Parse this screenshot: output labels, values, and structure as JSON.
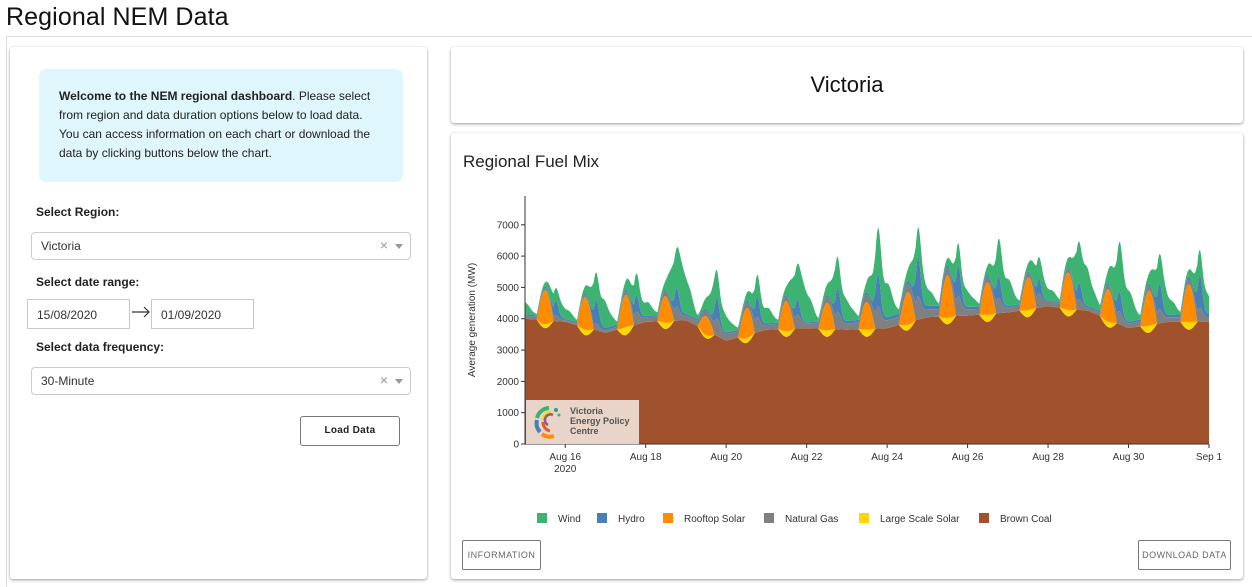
{
  "page_title": "Regional NEM Data",
  "welcome": {
    "bold": "Welcome to the NEM regional dashboard",
    "text": ". Please select from region and data duration options below to load data. You can access information on each chart or download the data by clicking buttons below the chart."
  },
  "controls": {
    "region_label": "Select Region:",
    "region_value": "Victoria",
    "date_label": "Select date range:",
    "date_start": "15/08/2020",
    "date_end": "01/09/2020",
    "frequency_label": "Select data frequency:",
    "frequency_value": "30-Minute",
    "clear_symbol": "×",
    "load_button": "Load Data"
  },
  "region_title": "Victoria",
  "chart_title": "Regional Fuel Mix",
  "buttons": {
    "information": "INFORMATION",
    "download": "DOWNLOAD DATA"
  },
  "logo": {
    "line1": "Victoria",
    "line2": "Energy Policy",
    "line3": "Centre"
  },
  "colors": {
    "wind": "#3cb371",
    "hydro": "#4a7fb5",
    "rooftop_solar": "#ff8c00",
    "natural_gas": "#808080",
    "large_scale_solar": "#ffd700",
    "brown_coal": "#a0522d",
    "welcome_bg": "#dff6fc"
  },
  "chart_data": {
    "type": "area",
    "stacked": true,
    "title": "Regional Fuel Mix",
    "ylabel": "Average generation (MW)",
    "xlabel": "",
    "ylim": [
      0,
      7600
    ],
    "xlim": [
      "2020-08-15",
      "2020-09-01"
    ],
    "yticks": [
      0,
      1000,
      2000,
      3000,
      4000,
      5000,
      6000,
      7000
    ],
    "xticks": [
      {
        "date": "2020-08-16",
        "label": "Aug 16",
        "sublabel": "2020"
      },
      {
        "date": "2020-08-18",
        "label": "Aug 18"
      },
      {
        "date": "2020-08-20",
        "label": "Aug 20"
      },
      {
        "date": "2020-08-22",
        "label": "Aug 22"
      },
      {
        "date": "2020-08-24",
        "label": "Aug 24"
      },
      {
        "date": "2020-08-26",
        "label": "Aug 26"
      },
      {
        "date": "2020-08-28",
        "label": "Aug 28"
      },
      {
        "date": "2020-08-30",
        "label": "Aug 30"
      },
      {
        "date": "2020-09-01",
        "label": "Sep 1"
      }
    ],
    "legend_position": "bottom",
    "series_order": [
      "Brown Coal",
      "Large Scale Solar",
      "Rooftop Solar",
      "Natural Gas",
      "Hydro",
      "Wind"
    ],
    "legend": [
      "Wind",
      "Hydro",
      "Rooftop Solar",
      "Natural Gas",
      "Large Scale Solar",
      "Brown Coal"
    ],
    "series_colors": {
      "Wind": "#3cb371",
      "Hydro": "#4a7fb5",
      "Rooftop Solar": "#ff8c00",
      "Natural Gas": "#808080",
      "Large Scale Solar": "#ffd700",
      "Brown Coal": "#a0522d"
    },
    "daily": [
      {
        "date": "2020-08-15",
        "Brown Coal": 4000,
        "Large Scale Solar": 100,
        "Rooftop Solar": 650,
        "Natural Gas": 200,
        "Hydro": 250,
        "Wind": 500
      },
      {
        "date": "2020-08-16",
        "Brown Coal": 3900,
        "Large Scale Solar": 150,
        "Rooftop Solar": 700,
        "Natural Gas": 100,
        "Hydro": 200,
        "Wind": 500
      },
      {
        "date": "2020-08-17",
        "Brown Coal": 3550,
        "Large Scale Solar": 200,
        "Rooftop Solar": 600,
        "Natural Gas": 150,
        "Hydro": 400,
        "Wind": 1100
      },
      {
        "date": "2020-08-18",
        "Brown Coal": 3900,
        "Large Scale Solar": 300,
        "Rooftop Solar": 700,
        "Natural Gas": 300,
        "Hydro": 200,
        "Wind": 600
      },
      {
        "date": "2020-08-19",
        "Brown Coal": 3950,
        "Large Scale Solar": 100,
        "Rooftop Solar": 350,
        "Natural Gas": 300,
        "Hydro": 300,
        "Wind": 1800
      },
      {
        "date": "2020-08-20",
        "Brown Coal": 3300,
        "Large Scale Solar": 100,
        "Rooftop Solar": 400,
        "Natural Gas": 400,
        "Hydro": 300,
        "Wind": 700
      },
      {
        "date": "2020-08-21",
        "Brown Coal": 3650,
        "Large Scale Solar": 200,
        "Rooftop Solar": 800,
        "Natural Gas": 300,
        "Hydro": 300,
        "Wind": 700
      },
      {
        "date": "2020-08-22",
        "Brown Coal": 3700,
        "Large Scale Solar": 150,
        "Rooftop Solar": 400,
        "Natural Gas": 300,
        "Hydro": 200,
        "Wind": 1500
      },
      {
        "date": "2020-08-23",
        "Brown Coal": 3650,
        "Large Scale Solar": 250,
        "Rooftop Solar": 700,
        "Natural Gas": 400,
        "Hydro": 400,
        "Wind": 900
      },
      {
        "date": "2020-08-24",
        "Brown Coal": 3700,
        "Large Scale Solar": 200,
        "Rooftop Solar": 400,
        "Natural Gas": 500,
        "Hydro": 500,
        "Wind": 1600
      },
      {
        "date": "2020-08-25",
        "Brown Coal": 4050,
        "Large Scale Solar": 150,
        "Rooftop Solar": 900,
        "Natural Gas": 500,
        "Hydro": 600,
        "Wind": 900
      },
      {
        "date": "2020-08-26",
        "Brown Coal": 4100,
        "Large Scale Solar": 250,
        "Rooftop Solar": 800,
        "Natural Gas": 400,
        "Hydro": 400,
        "Wind": 700
      },
      {
        "date": "2020-08-27",
        "Brown Coal": 4200,
        "Large Scale Solar": 200,
        "Rooftop Solar": 500,
        "Natural Gas": 300,
        "Hydro": 300,
        "Wind": 1300
      },
      {
        "date": "2020-08-28",
        "Brown Coal": 4400,
        "Large Scale Solar": 250,
        "Rooftop Solar": 800,
        "Natural Gas": 300,
        "Hydro": 200,
        "Wind": 600
      },
      {
        "date": "2020-08-29",
        "Brown Coal": 4250,
        "Large Scale Solar": 150,
        "Rooftop Solar": 700,
        "Natural Gas": 200,
        "Hydro": 250,
        "Wind": 1600
      },
      {
        "date": "2020-08-30",
        "Brown Coal": 3700,
        "Large Scale Solar": 200,
        "Rooftop Solar": 600,
        "Natural Gas": 300,
        "Hydro": 300,
        "Wind": 1500
      },
      {
        "date": "2020-08-31",
        "Brown Coal": 3900,
        "Large Scale Solar": 250,
        "Rooftop Solar": 800,
        "Natural Gas": 300,
        "Hydro": 400,
        "Wind": 900
      },
      {
        "date": "2020-09-01",
        "Brown Coal": 3900,
        "Large Scale Solar": 250,
        "Rooftop Solar": 700,
        "Natural Gas": 300,
        "Hydro": 500,
        "Wind": 800
      }
    ]
  }
}
